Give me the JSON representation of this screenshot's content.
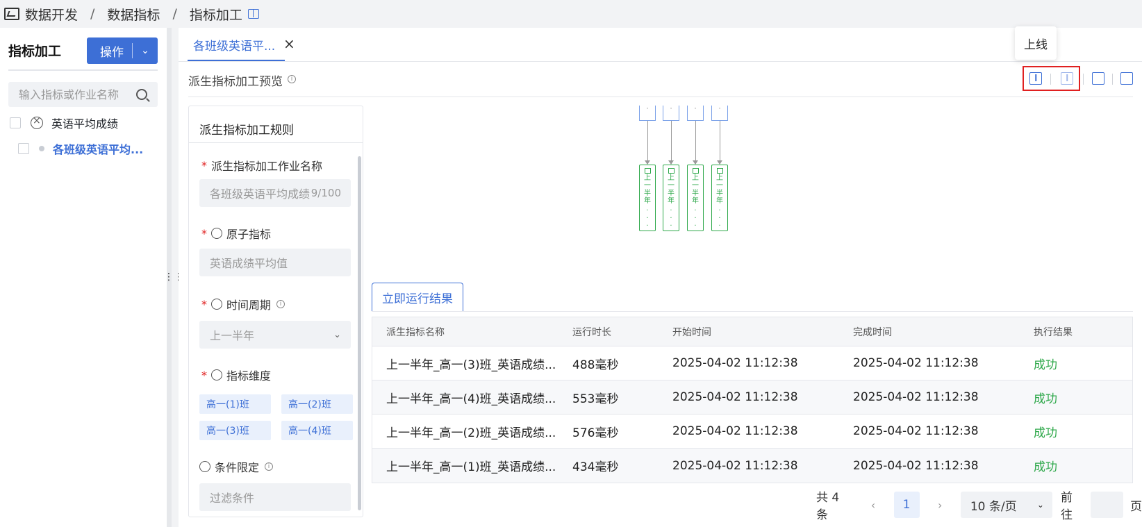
{
  "breadcrumb": [
    "数据开发",
    "数据指标",
    "指标加工"
  ],
  "left": {
    "title": "指标加工",
    "op_button": "操作",
    "search_placeholder": "输入指标或作业名称",
    "tree": [
      {
        "label": "英语平均成绩"
      },
      {
        "label": "各班级英语平均..."
      }
    ]
  },
  "tabs": [
    {
      "label": "各班级英语平..."
    }
  ],
  "preview": {
    "title": "派生指标加工预览"
  },
  "tooltip": "上线",
  "rules": {
    "title": "派生指标加工规则",
    "job_name_label": "派生指标加工作业名称",
    "job_name_value": "各班级英语平均成绩",
    "job_name_count": "9/100",
    "atomic_label": "原子指标",
    "atomic_value": "英语成绩平均值",
    "period_label": "时间周期",
    "period_value": "上一半年",
    "dimension_label": "指标维度",
    "dimensions": [
      "高一(1)班",
      "高一(2)班",
      "高一(3)班",
      "高一(4)班"
    ],
    "condition_label": "条件限定",
    "condition_placeholder": "过滤条件"
  },
  "diagram": {
    "nodes": [
      "上一半年|...",
      "上一半年|...",
      "上一半年|...",
      "上一半年|..."
    ]
  },
  "results": {
    "tab": "立即运行结果",
    "columns": [
      "派生指标名称",
      "运行时长",
      "开始时间",
      "完成时间",
      "执行结果"
    ],
    "rows": [
      [
        "上一半年_高一(3)班_英语成绩...",
        "488毫秒",
        "2025-04-02 11:12:38",
        "2025-04-02 11:12:38",
        "成功"
      ],
      [
        "上一半年_高一(4)班_英语成绩...",
        "553毫秒",
        "2025-04-02 11:12:38",
        "2025-04-02 11:12:38",
        "成功"
      ],
      [
        "上一半年_高一(2)班_英语成绩...",
        "576毫秒",
        "2025-04-02 11:12:38",
        "2025-04-02 11:12:38",
        "成功"
      ],
      [
        "上一半年_高一(1)班_英语成绩...",
        "434毫秒",
        "2025-04-02 11:12:38",
        "2025-04-02 11:12:38",
        "成功"
      ]
    ]
  },
  "pager": {
    "total": "共 4 条",
    "page": "1",
    "size": "10 条/页",
    "goto": "前往",
    "page_suffix": "页"
  }
}
